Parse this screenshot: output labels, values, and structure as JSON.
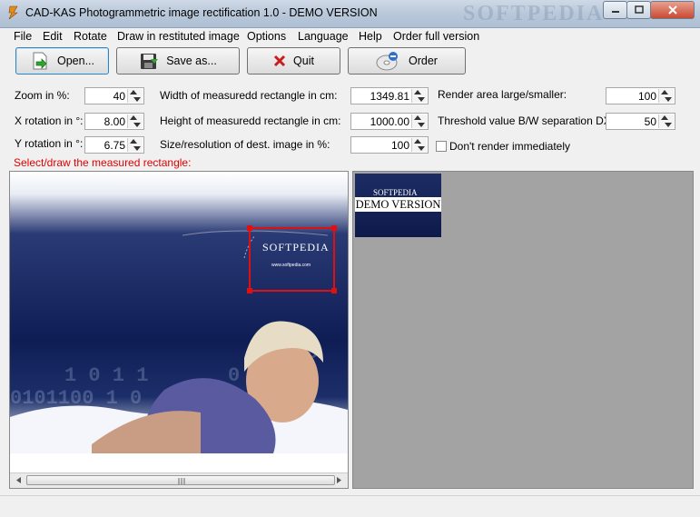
{
  "window": {
    "title": "CAD-KAS Photogrammetric image rectification 1.0 - DEMO VERSION",
    "watermark": "SOFTPEDIA"
  },
  "menu": [
    "File",
    "Edit",
    "Rotate",
    "Draw in restituted image",
    "Options",
    "Language",
    "Help",
    "Order full version"
  ],
  "toolbar": {
    "open_label": "Open...",
    "save_label": "Save as...",
    "quit_label": "Quit",
    "order_label": "Order"
  },
  "params": {
    "zoom_label": "Zoom in %:",
    "zoom_value": "40",
    "xrot_label": "X rotation in °:",
    "xrot_value": "8.00",
    "yrot_label": "Y rotation in °:",
    "yrot_value": "6.75",
    "width_label": "Width of measuredd rectangle in cm:",
    "width_value": "1349.81",
    "height_label": "Height of measuredd rectangle in cm:",
    "height_value": "1000.00",
    "size_label": "Size/resolution of dest. image in %:",
    "size_value": "100",
    "render_label": "Render area large/smaller:",
    "render_value": "100",
    "threshold_label": "Threshold value B/W separation DXF:",
    "threshold_value": "50",
    "dont_render_label": "Don't render immediately"
  },
  "hint": "Select/draw the measured rectangle:",
  "source_image": {
    "banner_text": "SOFTPEDIA",
    "banner_url": "www.softpedia.com"
  },
  "result_image": {
    "top_text": "SOFTPEDIA",
    "band_text": "DEMO VERSION"
  },
  "colors": {
    "hint": "#e00000",
    "selection": "#e01010",
    "result_panel_bg": "#a3a3a3"
  }
}
